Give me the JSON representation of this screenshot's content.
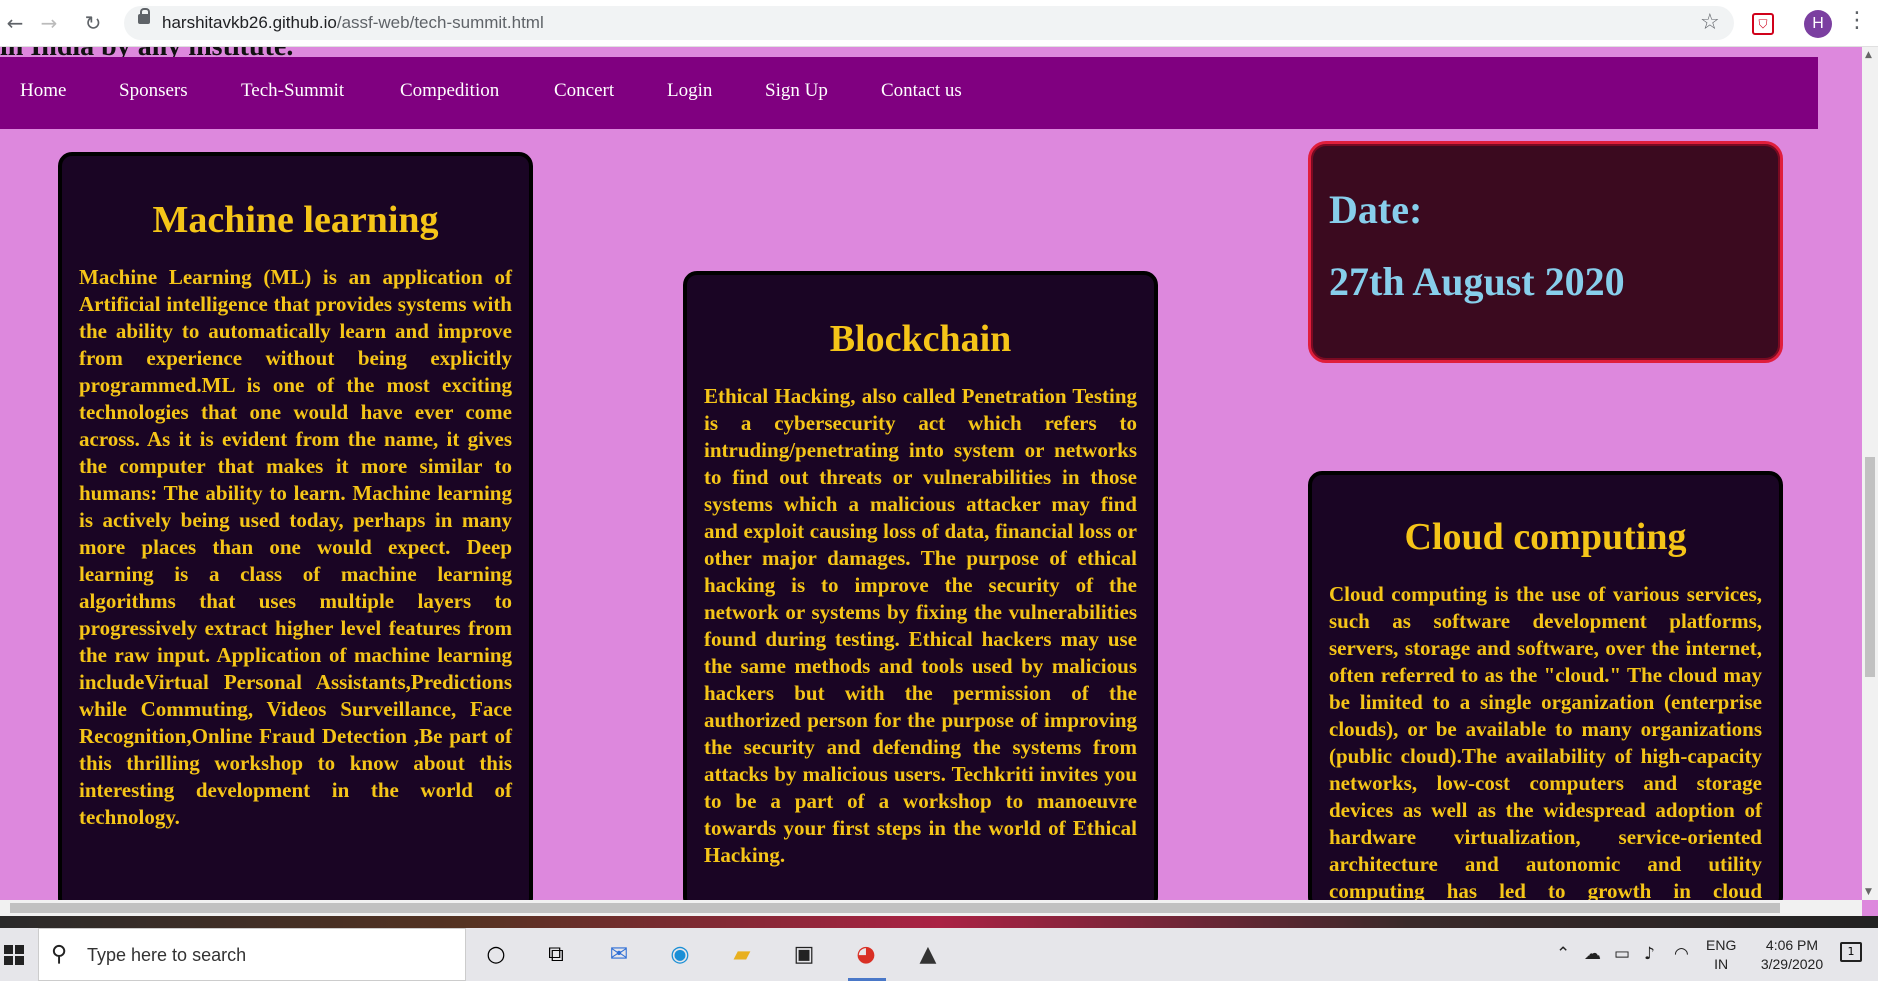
{
  "browser": {
    "url_host": "harshitavkb26.github.io",
    "url_path": "/assf-web/tech-summit.html",
    "profile_initial": "H",
    "ext_glyph": "⛉"
  },
  "page": {
    "cut_text": "in India by any institute.",
    "nav": [
      "Home",
      "Sponsers",
      "Tech-Summit",
      "Compedition",
      "Concert",
      "Login",
      "Sign Up",
      "Contact us"
    ],
    "cards": {
      "ml": {
        "title": "Machine learning",
        "body": "Machine Learning (ML) is an application of Artificial intelligence that provides systems with the ability to automatically learn and improve from experience without being explicitly programmed.ML is one of the most exciting technologies that one would have ever come across. As it is evident from the name, it gives the computer that makes it more similar to humans: The ability to learn. Machine learning is actively being used today, perhaps in many more places than one would expect. Deep learning is a class of machine learning algorithms that uses multiple layers to progressively extract higher level features from the raw input. Application of machine learning includeVirtual Personal Assistants,Predictions while Commuting, Videos Surveillance, Face Recognition,Online Fraud Detection ,Be part of this thrilling workshop to know about this interesting development in the world of technology."
      },
      "blockchain": {
        "title": "Blockchain",
        "body": "Ethical Hacking, also called Penetration Testing is a cybersecurity act which refers to intruding/penetrating into system or networks to find out threats or vulnerabilities in those systems which a malicious attacker may find and exploit causing loss of data, financial loss or other major damages. The purpose of ethical hacking is to improve the security of the network or systems by fixing the vulnerabilities found during testing. Ethical hackers may use the same methods and tools used by malicious hackers but with the permission of the authorized person for the purpose of improving the security and defending the systems from attacks by malicious users. Techkriti invites you to be a part of a workshop to manoeuvre towards your first steps in the world of Ethical Hacking."
      },
      "cloud": {
        "title": "Cloud computing",
        "body": "Cloud computing is the use of various services, such as software development platforms, servers, storage and software, over the internet, often referred to as the \"cloud.\" The cloud may be limited to a single organization (enterprise clouds), or be available to many organizations (public cloud).The availability of high-capacity networks, low-cost computers and storage devices as well as the widespread adoption of hardware virtualization, service-oriented architecture and autonomic and utility computing has led to growth in cloud computing."
      }
    },
    "date": {
      "label": "Date:",
      "value": "27th August 2020"
    }
  },
  "taskbar": {
    "search_placeholder": "Type here to search",
    "lang_line1": "ENG",
    "lang_line2": "IN",
    "time": "4:06 PM",
    "date": "3/29/2020",
    "notif_count": "1"
  },
  "colors": {
    "page_bg": "#dd88dd",
    "navbar": "#800080",
    "card_bg": "#1a0524",
    "card_text": "#f5c518",
    "date_text": "#87ceeb",
    "date_border": "#e01e3c"
  }
}
